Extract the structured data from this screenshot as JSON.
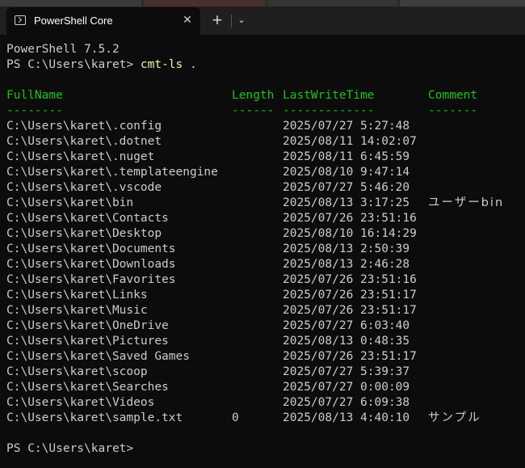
{
  "window": {
    "tab_title": "PowerShell Core",
    "close_glyph": "✕",
    "new_tab_glyph": "+",
    "dropdown_glyph": "⌄"
  },
  "terminal": {
    "version_line": "PowerShell 7.5.2",
    "prompt1": "PS C:\\Users\\karet> ",
    "command": "cmt-ls",
    "command_arg": " .",
    "headers": {
      "fullname": "FullName",
      "length": "Length",
      "lastwrite": "LastWriteTime",
      "comment": "Comment"
    },
    "underlines": {
      "fullname": "--------",
      "length": "------",
      "lastwrite": "-------------",
      "comment": "-------"
    },
    "rows": [
      {
        "name": "C:\\Users\\karet\\.config",
        "length": "",
        "time": "2025/07/27 5:27:48",
        "comment": ""
      },
      {
        "name": "C:\\Users\\karet\\.dotnet",
        "length": "",
        "time": "2025/08/11 14:02:07",
        "comment": ""
      },
      {
        "name": "C:\\Users\\karet\\.nuget",
        "length": "",
        "time": "2025/08/11 6:45:59",
        "comment": ""
      },
      {
        "name": "C:\\Users\\karet\\.templateengine",
        "length": "",
        "time": "2025/08/10 9:47:14",
        "comment": ""
      },
      {
        "name": "C:\\Users\\karet\\.vscode",
        "length": "",
        "time": "2025/07/27 5:46:20",
        "comment": ""
      },
      {
        "name": "C:\\Users\\karet\\bin",
        "length": "",
        "time": "2025/08/13 3:17:25",
        "comment": "ユーザーbin"
      },
      {
        "name": "C:\\Users\\karet\\Contacts",
        "length": "",
        "time": "2025/07/26 23:51:16",
        "comment": ""
      },
      {
        "name": "C:\\Users\\karet\\Desktop",
        "length": "",
        "time": "2025/08/10 16:14:29",
        "comment": ""
      },
      {
        "name": "C:\\Users\\karet\\Documents",
        "length": "",
        "time": "2025/08/13 2:50:39",
        "comment": ""
      },
      {
        "name": "C:\\Users\\karet\\Downloads",
        "length": "",
        "time": "2025/08/13 2:46:28",
        "comment": ""
      },
      {
        "name": "C:\\Users\\karet\\Favorites",
        "length": "",
        "time": "2025/07/26 23:51:16",
        "comment": ""
      },
      {
        "name": "C:\\Users\\karet\\Links",
        "length": "",
        "time": "2025/07/26 23:51:17",
        "comment": ""
      },
      {
        "name": "C:\\Users\\karet\\Music",
        "length": "",
        "time": "2025/07/26 23:51:17",
        "comment": ""
      },
      {
        "name": "C:\\Users\\karet\\OneDrive",
        "length": "",
        "time": "2025/07/27 6:03:40",
        "comment": ""
      },
      {
        "name": "C:\\Users\\karet\\Pictures",
        "length": "",
        "time": "2025/08/13 0:48:35",
        "comment": ""
      },
      {
        "name": "C:\\Users\\karet\\Saved Games",
        "length": "",
        "time": "2025/07/26 23:51:17",
        "comment": ""
      },
      {
        "name": "C:\\Users\\karet\\scoop",
        "length": "",
        "time": "2025/07/27 5:39:37",
        "comment": ""
      },
      {
        "name": "C:\\Users\\karet\\Searches",
        "length": "",
        "time": "2025/07/27 0:00:09",
        "comment": ""
      },
      {
        "name": "C:\\Users\\karet\\Videos",
        "length": "",
        "time": "2025/07/27 6:09:38",
        "comment": ""
      },
      {
        "name": "C:\\Users\\karet\\sample.txt",
        "length": "0",
        "time": "2025/08/13 4:40:10",
        "comment": "サンプル"
      }
    ],
    "prompt2": "PS C:\\Users\\karet>"
  },
  "colors": {
    "background": "#0c0c0c",
    "titlebar": "#1f1f1f",
    "text": "#cccccc",
    "header_green": "#16c60c",
    "command_yellow": "#f9f1a5"
  }
}
